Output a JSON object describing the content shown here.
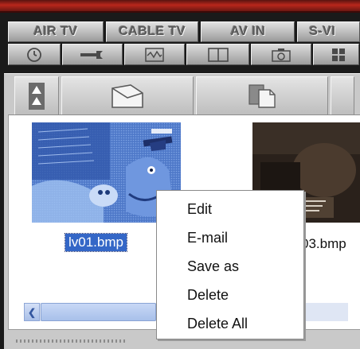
{
  "source_tabs": [
    {
      "label": "AIR TV"
    },
    {
      "label": "CABLE TV"
    },
    {
      "label": "AV IN"
    },
    {
      "label": "S-VI"
    }
  ],
  "toolbar": {
    "icons": [
      "clock-icon",
      "wrench-icon",
      "waveform-icon",
      "split-view-icon",
      "camera-icon",
      "grid-icon"
    ]
  },
  "panel_tabs": {
    "icons": [
      "up-arrows-icon",
      "envelope-icon",
      "copy-pages-icon"
    ]
  },
  "thumbnails": [
    {
      "caption": "lv01.bmp",
      "selected": true
    },
    {
      "caption": "03.bmp",
      "selected": false
    }
  ],
  "context_menu": {
    "items": [
      {
        "label": "Edit"
      },
      {
        "label": "E-mail"
      },
      {
        "label": "Save as"
      },
      {
        "label": "Delete"
      },
      {
        "label": "Delete All"
      }
    ]
  },
  "colors": {
    "accent_red": "#b8271c",
    "selection_blue": "#3467c7",
    "chrome_gray": "#c9c9c9"
  }
}
